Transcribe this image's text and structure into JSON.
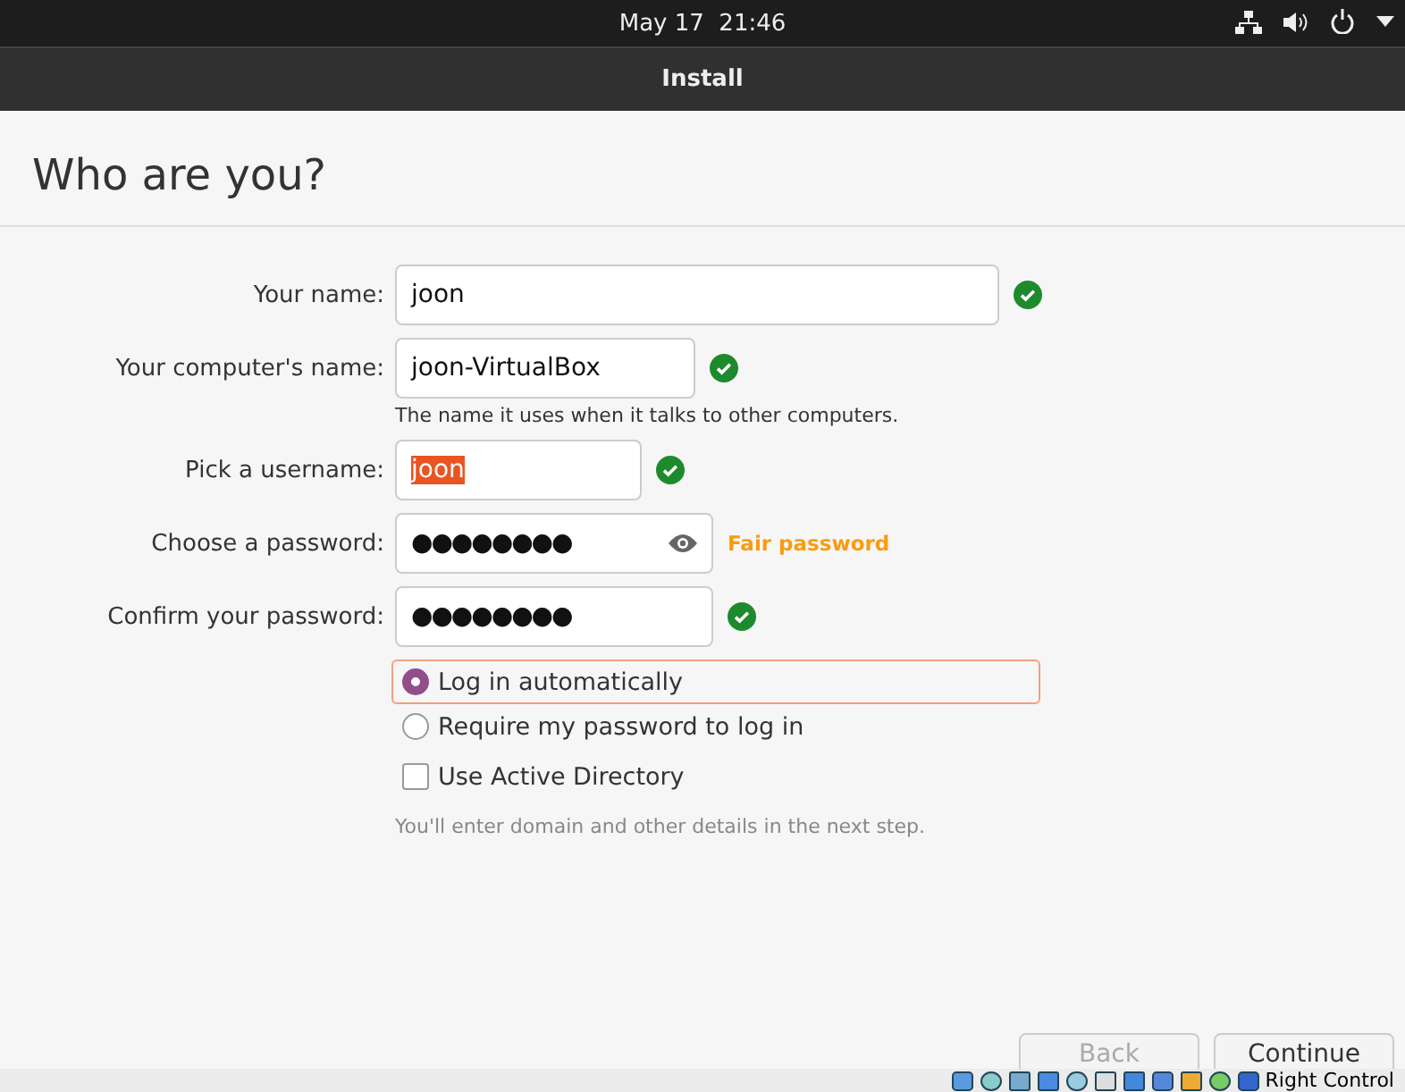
{
  "top_bar": {
    "clock": "May 17  21:46"
  },
  "window": {
    "title": "Install"
  },
  "heading": "Who are you?",
  "fields": [
    {
      "label": "Your name:",
      "value": "joon",
      "valid": true,
      "selected_text": false,
      "masked": false
    },
    {
      "label": "Your computer's name:",
      "value": "joon-VirtualBox",
      "valid": true,
      "selected_text": false,
      "masked": false,
      "hint": "The name it uses when it talks to other computers."
    },
    {
      "label": "Pick a username:",
      "value": "joon",
      "valid": true,
      "selected_text": true,
      "masked": false
    },
    {
      "label": "Choose a password:",
      "value": "●●●●●●●●",
      "valid": false,
      "selected_text": false,
      "masked": true,
      "strength": "Fair password"
    },
    {
      "label": "Confirm your password:",
      "value": "●●●●●●●●",
      "valid": true,
      "selected_text": false,
      "masked": false
    }
  ],
  "login_options": [
    {
      "label": "Log in automatically",
      "selected": true
    },
    {
      "label": "Require my password to log in",
      "selected": false
    }
  ],
  "active_directory": {
    "label": "Use Active Directory",
    "checked": false,
    "note": "You'll enter domain and other details in the next step."
  },
  "buttons": [
    {
      "label": "Back",
      "disabled": true
    },
    {
      "label": "Continue",
      "disabled": false
    }
  ],
  "vm_status_bar": {
    "host_key": "Right Control"
  }
}
